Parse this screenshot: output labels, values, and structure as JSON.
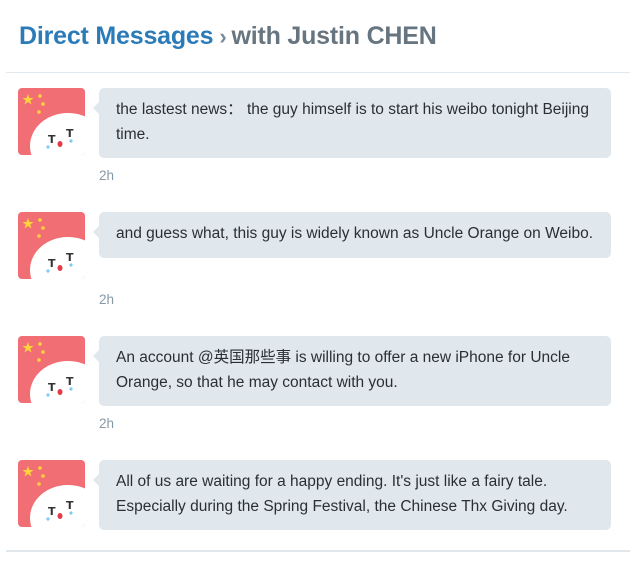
{
  "header": {
    "section_label": "Direct Messages",
    "separator": "›",
    "conversation_label": "with Justin CHEN"
  },
  "messages": [
    {
      "text": "the lastest news： the guy himself is to start his weibo tonight Beijing time.",
      "time": "2h"
    },
    {
      "text": "and guess what, this guy is widely known as Uncle Orange on Weibo.",
      "time": "2h"
    },
    {
      "text": "An account @英国那些事 is willing to offer a new iPhone for Uncle Orange, so that he may contact with you.",
      "time": "2h"
    },
    {
      "text": "All of us are waiting for a happy ending. It's just like a fairy tale. Especially during the Spring Festival, the Chinese Thx Giving day.",
      "time": ""
    }
  ],
  "colors": {
    "link_blue": "#2b7bb9",
    "bubble_bg": "#e1e8ed",
    "avatar_pink": "#f16e75"
  }
}
